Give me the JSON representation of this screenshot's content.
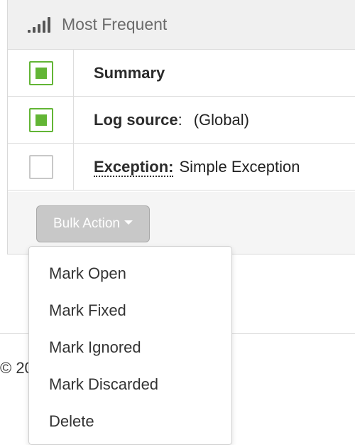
{
  "panel": {
    "header": {
      "icon": "signal-bars-icon",
      "title": "Most Frequent"
    },
    "rows": [
      {
        "checked": true,
        "label": "Summary",
        "value": ""
      },
      {
        "checked": true,
        "label": "Log source",
        "separator": ":",
        "value": "(Global)"
      },
      {
        "checked": false,
        "label": "Exception",
        "separator": ":",
        "value": "Simple Exception"
      }
    ],
    "bulk_action": {
      "label": "Bulk Action",
      "icon": "caret-down-icon"
    }
  },
  "dropdown": {
    "items": [
      "Mark Open",
      "Mark Fixed",
      "Mark Ignored",
      "Mark Discarded",
      "Delete"
    ]
  },
  "footer": {
    "visible_text": "© 20"
  },
  "colors": {
    "checkbox_checked": "#62b535",
    "panel_background": "#f5f5f5",
    "header_background": "#f0f0f0",
    "button_background": "#c8c8c8"
  }
}
